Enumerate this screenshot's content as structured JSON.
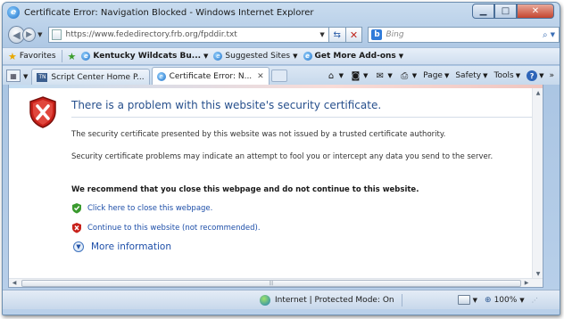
{
  "window": {
    "title": "Certificate Error: Navigation Blocked - Windows Internet Explorer",
    "buttons": {
      "minimize": "▁",
      "maximize": "□",
      "close": "✕"
    }
  },
  "address_bar": {
    "url": "https://www.fededirectory.frb.org/fpddir.txt",
    "search_placeholder": "Bing"
  },
  "favorites_bar": {
    "favorites_label": "Favorites",
    "items": [
      {
        "label": "Kentucky Wildcats Bu..."
      },
      {
        "label": "Suggested Sites"
      },
      {
        "label": "Get More Add-ons"
      }
    ]
  },
  "tabs": [
    {
      "label": "Script Center Home P...",
      "icon": "tn-icon",
      "active": false
    },
    {
      "label": "Certificate Error: N...",
      "icon": "ie-icon",
      "active": true
    }
  ],
  "command_bar": {
    "items": [
      {
        "label": "",
        "icon": "home-icon"
      },
      {
        "label": "",
        "icon": "feeds-icon"
      },
      {
        "label": "",
        "icon": "mail-icon"
      },
      {
        "label": "",
        "icon": "print-icon"
      },
      {
        "label": "Page",
        "icon": ""
      },
      {
        "label": "Safety",
        "icon": ""
      },
      {
        "label": "Tools",
        "icon": ""
      },
      {
        "label": "",
        "icon": "help-icon"
      }
    ],
    "overflow": "»"
  },
  "content": {
    "headline": "There is a problem with this website's security certificate.",
    "para1": "The security certificate presented by this website was not issued by a trusted certificate authority.",
    "para2": "Security certificate problems may indicate an attempt to fool you or intercept any data you send to the server.",
    "recommend": "We recommend that you close this webpage and do not continue to this website.",
    "close_link": "Click here to close this webpage.",
    "continue_link": "Continue to this website (not recommended).",
    "more_info": "More information"
  },
  "status_bar": {
    "zone": "Internet | Protected Mode: On",
    "zoom": "100%"
  },
  "colors": {
    "headline": "#264f8c",
    "link": "#1d4ea8",
    "shield_red": "#c8211a",
    "close_shield_green": "#3a9a2e"
  }
}
